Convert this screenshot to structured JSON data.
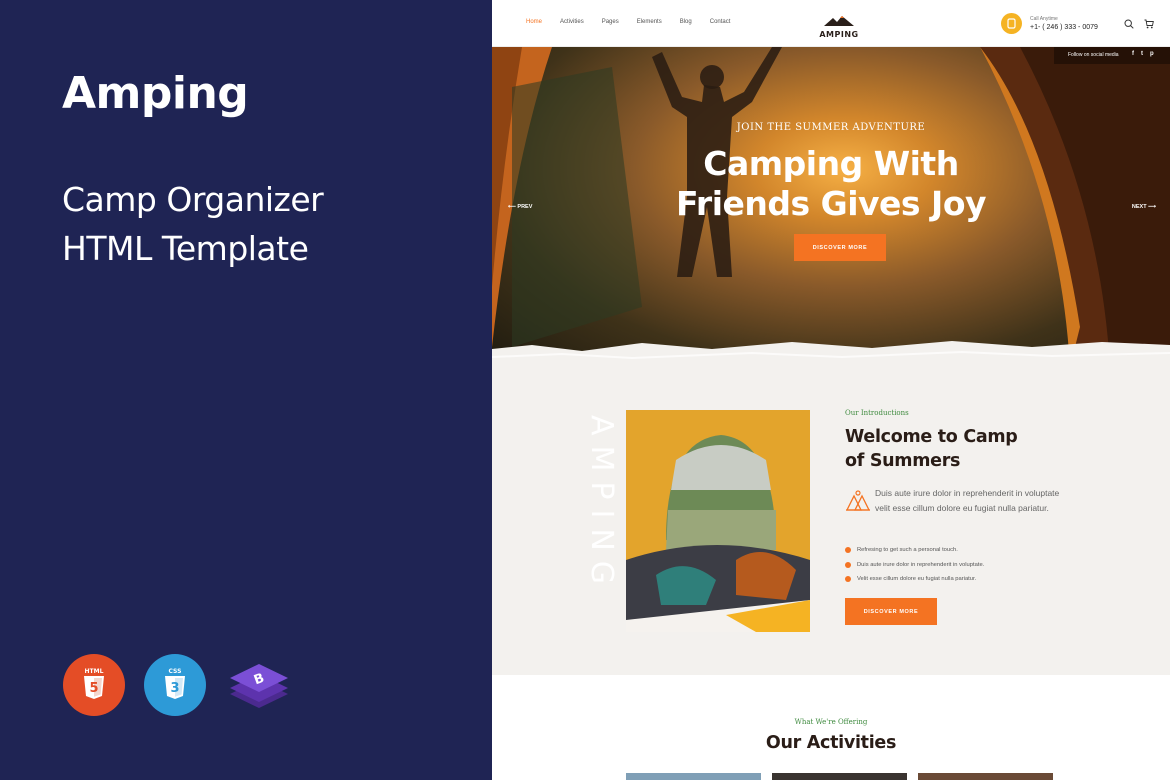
{
  "promo": {
    "title": "Amping",
    "subtitle_line1": "Camp Organizer",
    "subtitle_line2": "HTML Template",
    "tech_badges": [
      "html5-icon",
      "css3-icon",
      "bootstrap-icon"
    ],
    "colors": {
      "background": "#1f2454",
      "html5": "#e44d26",
      "css3": "#2d9ad7",
      "bootstrap": "#6f3fc9"
    }
  },
  "nav": {
    "links": [
      "Home",
      "Activities",
      "Pages",
      "Elements",
      "Blog",
      "Contact"
    ],
    "active": "Home",
    "logo": "AMPING",
    "call_label": "Call Anytime",
    "call_phone": "+1- ( 246 ) 333 - 0079",
    "icons": [
      "search-icon",
      "cart-icon"
    ]
  },
  "hero": {
    "social_label": "Follow on social media",
    "social_icons": [
      "f",
      "t",
      "p"
    ],
    "kicker": "JOIN THE SUMMER ADVENTURE",
    "title_line1": "Camping With",
    "title_line2": "Friends Gives Joy",
    "button": "DISCOVER MORE",
    "prev": "PREV",
    "next": "NEXT"
  },
  "about": {
    "vertical_text": "AMPING",
    "kicker": "Our Introductions",
    "title_line1": "Welcome to Camp",
    "title_line2": "of Summers",
    "lead": "Duis aute irure dolor in reprehenderit in voluptate velit esse cillum dolore eu fugiat nulla pariatur.",
    "checks": [
      "Refresing to get such a personal touch.",
      "Duis aute irure dolor in reprehenderit in voluptate.",
      "Velit esse cillum dolore eu fugiat nulla pariatur."
    ],
    "button": "DISCOVER MORE"
  },
  "activities": {
    "kicker": "What We're Offering",
    "title": "Our Activities"
  },
  "colors": {
    "accent": "#f47322",
    "yellow": "#f5b323",
    "green_kicker": "#3e8a3e",
    "heading": "#2a1d17"
  }
}
